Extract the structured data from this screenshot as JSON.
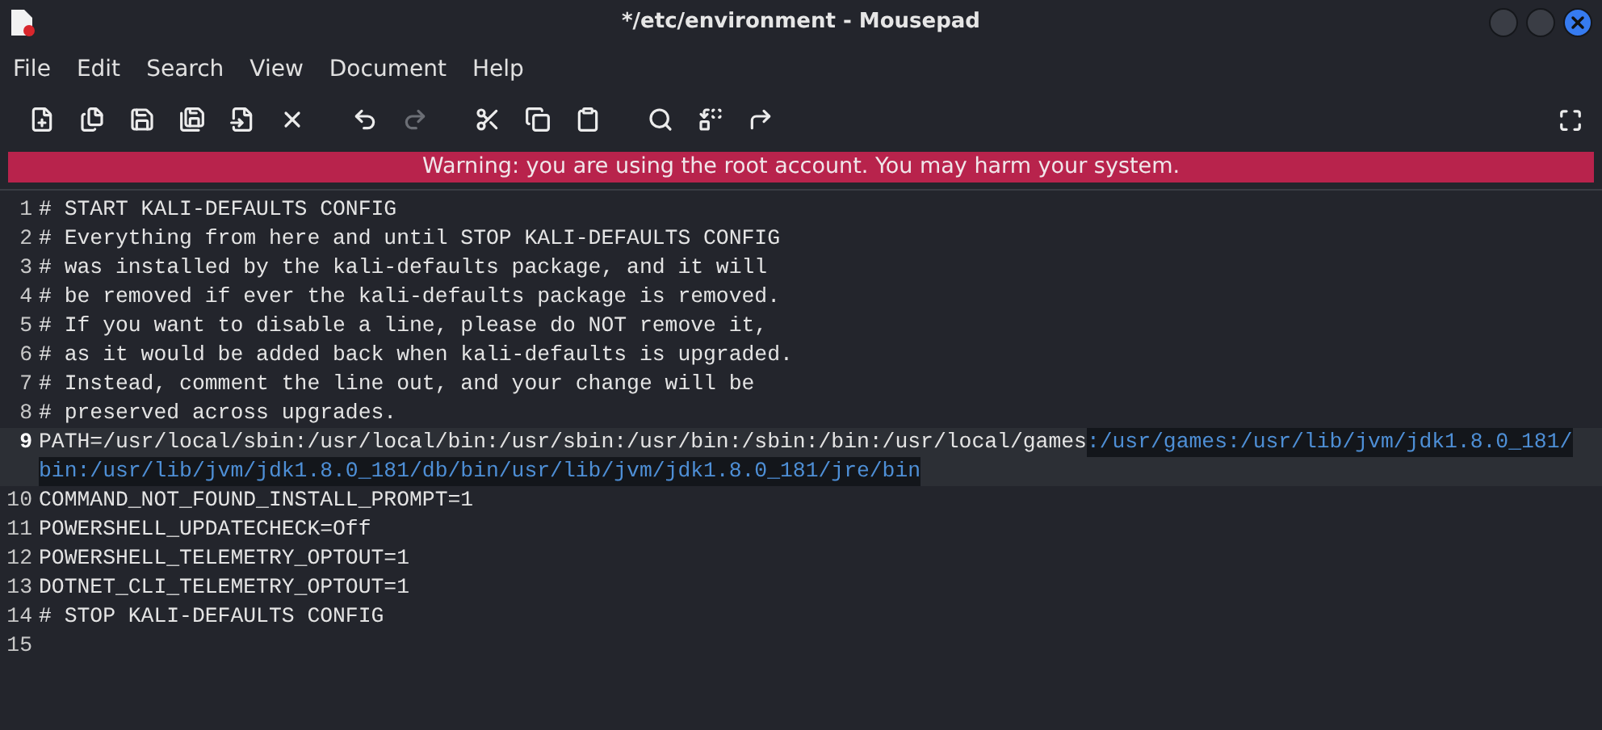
{
  "window": {
    "title": "*/etc/environment - Mousepad"
  },
  "menu": [
    "File",
    "Edit",
    "Search",
    "View",
    "Document",
    "Help"
  ],
  "toolbar": [
    {
      "kind": "new",
      "disabled": false
    },
    {
      "kind": "new-window",
      "disabled": false
    },
    {
      "kind": "save",
      "disabled": false
    },
    {
      "kind": "save-as",
      "disabled": false
    },
    {
      "kind": "revert",
      "disabled": false
    },
    {
      "kind": "close",
      "disabled": false
    },
    {
      "kind": "gap"
    },
    {
      "kind": "undo",
      "disabled": false
    },
    {
      "kind": "redo",
      "disabled": true
    },
    {
      "kind": "gap"
    },
    {
      "kind": "cut",
      "disabled": false
    },
    {
      "kind": "copy",
      "disabled": false
    },
    {
      "kind": "paste",
      "disabled": false
    },
    {
      "kind": "gap"
    },
    {
      "kind": "find",
      "disabled": false
    },
    {
      "kind": "replace",
      "disabled": false
    },
    {
      "kind": "goto",
      "disabled": false
    }
  ],
  "warning": "Warning: you are using the root account. You may harm your system.",
  "lines": [
    {
      "number": "1",
      "current": false,
      "rows": [
        [
          {
            "text": "# START KALI-DEFAULTS CONFIG",
            "selected": false
          }
        ]
      ]
    },
    {
      "number": "2",
      "current": false,
      "rows": [
        [
          {
            "text": "# Everything from here and until STOP KALI-DEFAULTS CONFIG",
            "selected": false
          }
        ]
      ]
    },
    {
      "number": "3",
      "current": false,
      "rows": [
        [
          {
            "text": "# was installed by the kali-defaults package, and it will",
            "selected": false
          }
        ]
      ]
    },
    {
      "number": "4",
      "current": false,
      "rows": [
        [
          {
            "text": "# be removed if ever the kali-defaults package is removed.",
            "selected": false
          }
        ]
      ]
    },
    {
      "number": "5",
      "current": false,
      "rows": [
        [
          {
            "text": "# If you want to disable a line, please do NOT remove it,",
            "selected": false
          }
        ]
      ]
    },
    {
      "number": "6",
      "current": false,
      "rows": [
        [
          {
            "text": "# as it would be added back when kali-defaults is upgraded.",
            "selected": false
          }
        ]
      ]
    },
    {
      "number": "7",
      "current": false,
      "rows": [
        [
          {
            "text": "# Instead, comment the line out, and your change will be",
            "selected": false
          }
        ]
      ]
    },
    {
      "number": "8",
      "current": false,
      "rows": [
        [
          {
            "text": "# preserved across upgrades.",
            "selected": false
          }
        ]
      ]
    },
    {
      "number": "9",
      "current": true,
      "rows": [
        [
          {
            "text": "PATH=/usr/local/sbin:/usr/local/bin:/usr/sbin:/usr/bin:/sbin:/bin:/usr/local/games",
            "selected": false
          },
          {
            "text": ":/usr/games:/usr/lib/jvm/jdk1.8.0_181/",
            "selected": true
          }
        ],
        [
          {
            "text": "bin:/usr/lib/jvm/jdk1.8.0_181/db/bin/usr/lib/jvm/jdk1.8.0_181/jre/bin",
            "selected": true
          }
        ]
      ]
    },
    {
      "number": "10",
      "current": false,
      "rows": [
        [
          {
            "text": "COMMAND_NOT_FOUND_INSTALL_PROMPT=1",
            "selected": false
          }
        ]
      ]
    },
    {
      "number": "11",
      "current": false,
      "rows": [
        [
          {
            "text": "POWERSHELL_UPDATECHECK=Off",
            "selected": false
          }
        ]
      ]
    },
    {
      "number": "12",
      "current": false,
      "rows": [
        [
          {
            "text": "POWERSHELL_TELEMETRY_OPTOUT=1",
            "selected": false
          }
        ]
      ]
    },
    {
      "number": "13",
      "current": false,
      "rows": [
        [
          {
            "text": "DOTNET_CLI_TELEMETRY_OPTOUT=1",
            "selected": false
          }
        ]
      ]
    },
    {
      "number": "14",
      "current": false,
      "rows": [
        [
          {
            "text": "# STOP KALI-DEFAULTS CONFIG",
            "selected": false
          }
        ]
      ]
    },
    {
      "number": "15",
      "current": false,
      "rows": [
        []
      ]
    }
  ]
}
